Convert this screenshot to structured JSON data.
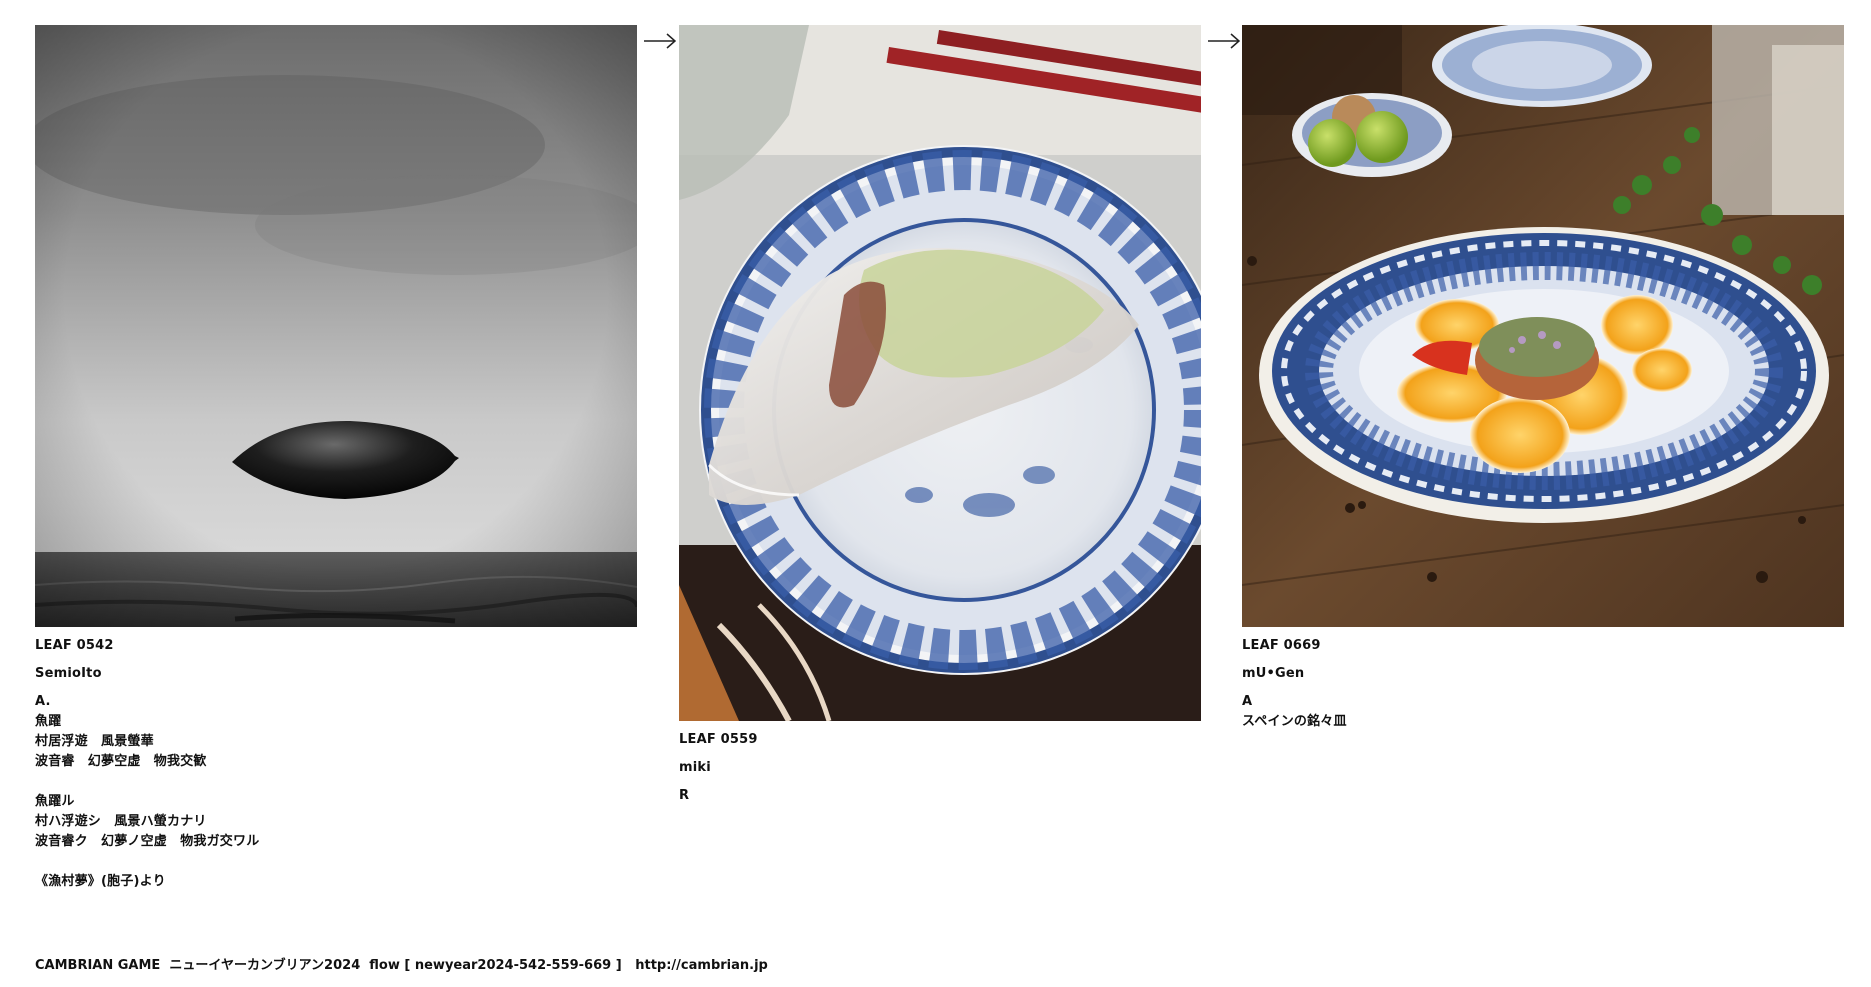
{
  "panels": [
    {
      "id": "LEAF 0542",
      "author": "SemioIto",
      "lines": [
        "A.",
        "魚躍",
        "村居浮遊　風景螢華",
        "波音睿　幻夢空虚　物我交歓",
        "",
        "魚躍ル",
        "村ハ浮遊シ　風景ハ螢カナリ",
        "波音睿ク　幻夢ノ空虚　物我ガ交ワル",
        "",
        "《漁村夢》(胞子)より"
      ],
      "image": "monochrome-sea-floating-object"
    },
    {
      "id": "LEAF 0559",
      "author": "miki",
      "lines": [
        "R"
      ],
      "image": "spring-roll-blue-plate"
    },
    {
      "id": "LEAF 0669",
      "author": "mU•Gen",
      "lines": [
        "A",
        "スペインの銘々皿"
      ],
      "image": "orange-slices-blue-plate"
    }
  ],
  "arrows": [
    "arrow-right-icon",
    "arrow-right-icon"
  ],
  "footer": "CAMBRIAN GAME  ニューイヤーカンブリアン2024  flow [ newyear2024-542-559-669 ]   http://cambrian.jp",
  "colors": {
    "porcelain_blue": "#2f4f8f",
    "orange": "#f3a21a",
    "wood": "#6b4a2e"
  }
}
